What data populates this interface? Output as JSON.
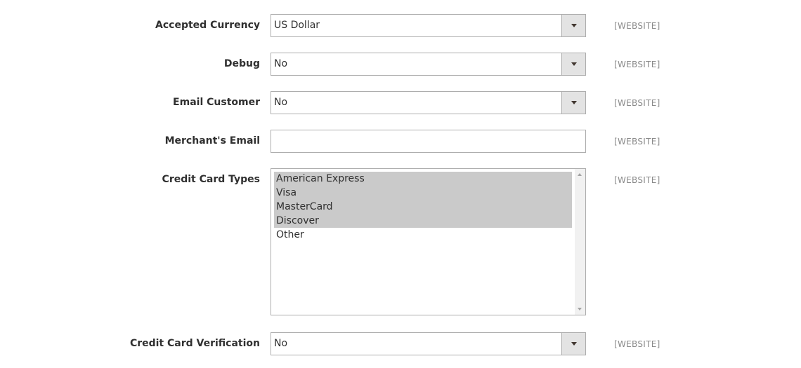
{
  "fields": {
    "accepted_currency": {
      "label": "Accepted Currency",
      "value": "US Dollar",
      "scope": "[WEBSITE]"
    },
    "debug": {
      "label": "Debug",
      "value": "No",
      "scope": "[WEBSITE]"
    },
    "email_customer": {
      "label": "Email Customer",
      "value": "No",
      "scope": "[WEBSITE]"
    },
    "merchant_email": {
      "label": "Merchant's Email",
      "value": "",
      "placeholder": "",
      "scope": "[WEBSITE]"
    },
    "credit_card_types": {
      "label": "Credit Card Types",
      "scope": "[WEBSITE]",
      "options": [
        {
          "label": "American Express",
          "selected": true
        },
        {
          "label": "Visa",
          "selected": true
        },
        {
          "label": "MasterCard",
          "selected": true
        },
        {
          "label": "Discover",
          "selected": true
        },
        {
          "label": "Other",
          "selected": false
        }
      ]
    },
    "credit_card_verification": {
      "label": "Credit Card Verification",
      "value": "No",
      "scope": "[WEBSITE]"
    }
  },
  "icons": {
    "dropdown": "chevron-down-icon",
    "scroll_up": "scroll-up-arrow-icon",
    "scroll_down": "scroll-down-arrow-icon"
  },
  "colors": {
    "selected_option_bg": "#cacaca",
    "dropdown_button_bg": "#e3e3e3",
    "border": "#adadad",
    "scope_text": "#8a8a8a"
  }
}
